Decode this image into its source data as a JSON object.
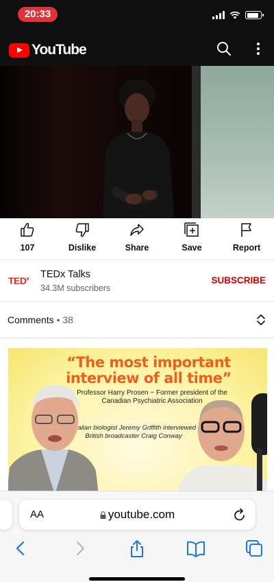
{
  "status_bar": {
    "time": "20:33"
  },
  "header": {
    "logo_text": "YouTube",
    "search_icon": "search-icon",
    "more_icon": "more-vertical-icon"
  },
  "actions": [
    {
      "id": "like",
      "label": "107",
      "icon": "thumbs-up-icon"
    },
    {
      "id": "dislike",
      "label": "Dislike",
      "icon": "thumbs-down-icon"
    },
    {
      "id": "share",
      "label": "Share",
      "icon": "share-icon"
    },
    {
      "id": "save",
      "label": "Save",
      "icon": "save-playlist-icon"
    },
    {
      "id": "report",
      "label": "Report",
      "icon": "flag-icon"
    }
  ],
  "channel": {
    "logo_text": "TED",
    "logo_sup": "x",
    "name": "TEDx Talks",
    "subscribers": "34.3M subscribers",
    "subscribe_label": "SUBSCRIBE"
  },
  "comments": {
    "label": "Comments",
    "separator": "•",
    "count": "38"
  },
  "thumbnail": {
    "headline": "“The most important interview of all time”",
    "subtitle": "Professor Harry Prosen ~ Former president of the Canadian Psychiatric Association",
    "caption": "Australian biologist Jeremy Griffith interviewed by British broadcaster Craig Conway"
  },
  "safari": {
    "aa_label": "AA",
    "url": "youtube.com"
  },
  "colors": {
    "brand_red": "#ff0000",
    "subscribe_red": "#cc0000",
    "ted_red": "#e62b1e",
    "time_pill": "#e0333a"
  }
}
